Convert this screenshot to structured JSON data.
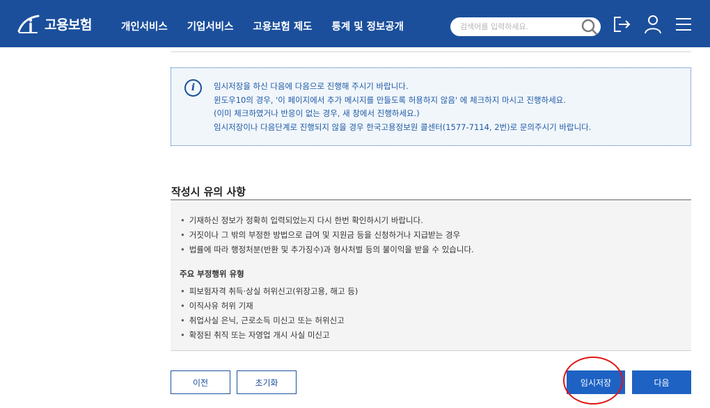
{
  "header": {
    "logo_text": "고용보험",
    "nav": [
      "개인서비스",
      "기업서비스",
      "고용보험 제도",
      "통계 및 정보공개"
    ],
    "search_placeholder": "검색어를 입력하세요.",
    "icons": [
      "logout-icon",
      "user-icon",
      "menu-icon"
    ],
    "color": "#1b4f9c"
  },
  "info": {
    "icon": "info-icon",
    "lines": [
      "임시저장을 하신 다음에 다음으로 진행해 주시기 바랍니다.",
      "윈도우10의 경우, '이 페이지에서 추가 메시지를 만들도록 허용하지 않음' 에 체크하지 마시고 진행하세요.",
      "(이미 체크하였거나 반응이 없는 경우, 새 창에서 진행하세요.)",
      "임시저장이나 다음단계로 진행되지 않을 경우 한국고용정보원 콜센터(1577-7114, 2번)로 문의주시기 바랍니다."
    ]
  },
  "caution": {
    "title": "작성시 유의 사항",
    "items": [
      "기재하신 정보가 정확히 입력되었는지 다시 한번 확인하시기 바랍니다.",
      "거짓이나 그 밖의 부정한 방법으로 급여 및 지원금 등을 신청하거나 지급받는 경우",
      "법률에 따라 행정처분(반환 및 추가징수)과 형사처벌 등의 불이익을 받을 수 있습니다."
    ],
    "sub_title": "주요 부정행위 유형",
    "sub_items": [
      "피보험자격 취득·상실 허위신고(위장고용, 해고 등)",
      "이직사유 허위 기재",
      "취업사실 은닉, 근로소득 미신고 또는 허위신고",
      "확정된 취직 또는 자영업 개시 사실 미신고"
    ]
  },
  "buttons": {
    "prev": "이전",
    "reset": "초기화",
    "temp_save": "임시저장",
    "next": "다음"
  },
  "highlight_color": "#e11414"
}
